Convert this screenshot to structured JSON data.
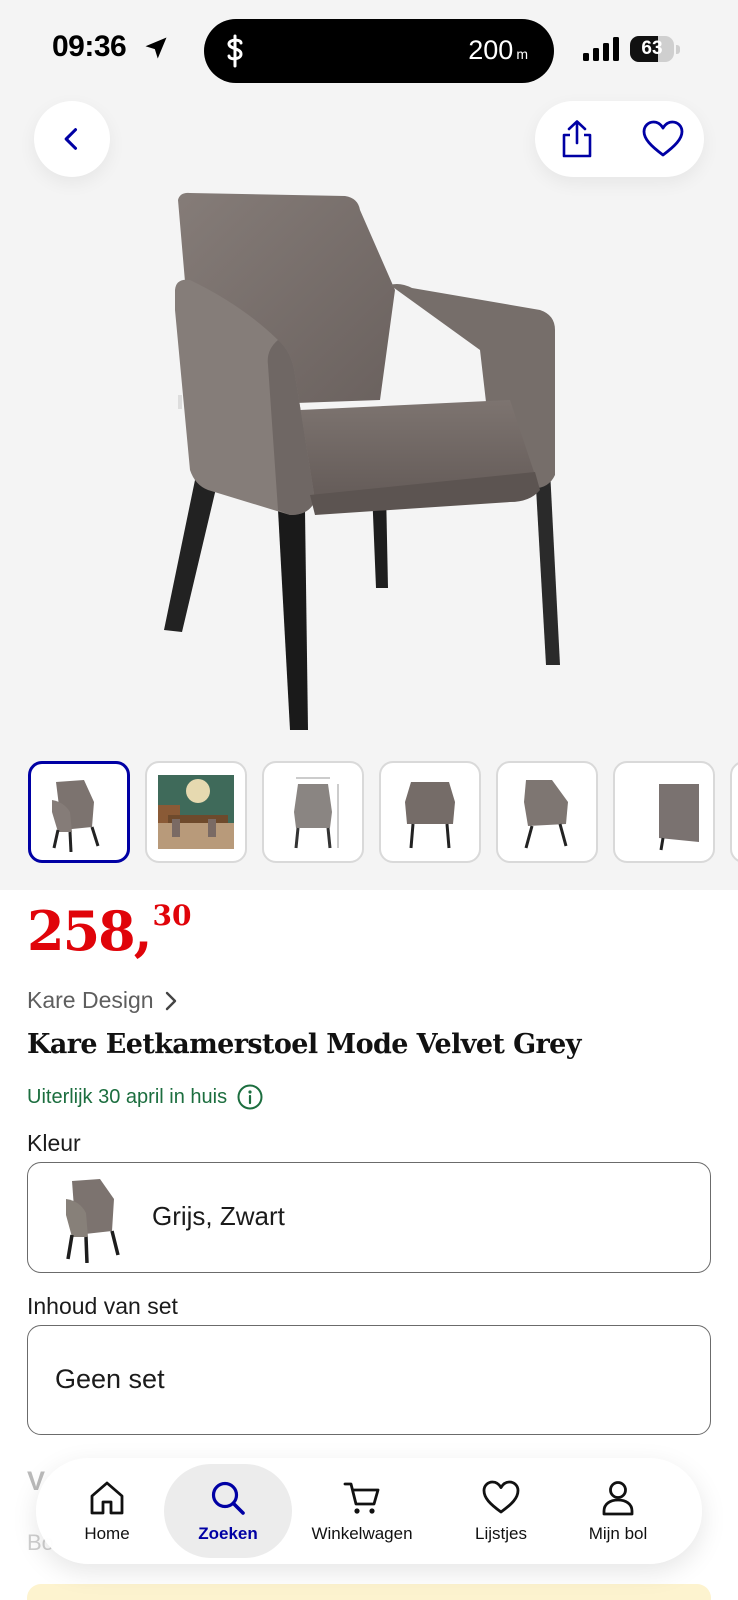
{
  "status_bar": {
    "time": "09:36",
    "navigation_distance": "200",
    "navigation_unit": "m",
    "battery_level": "63"
  },
  "product": {
    "price_whole": "258,",
    "price_cents": "30",
    "brand": "Kare Design",
    "title": "Kare Eetkamerstoel Mode Velvet Grey",
    "delivery": "Uiterlijk 30 april in huis",
    "color_label": "Kleur",
    "color_value": "Grijs, Zwart",
    "set_label": "Inhoud van set",
    "set_value": "Geen set",
    "partial_heading": "V",
    "partial_text": "Bo"
  },
  "tabbar": {
    "items": [
      {
        "label": "Home",
        "icon": "home-icon"
      },
      {
        "label": "Zoeken",
        "icon": "search-icon",
        "active": true
      },
      {
        "label": "Winkelwagen",
        "icon": "cart-icon"
      },
      {
        "label": "Lijstjes",
        "icon": "heart-icon"
      },
      {
        "label": "Mijn bol",
        "icon": "user-icon"
      }
    ]
  },
  "colors": {
    "price": "#e0040a",
    "brand_blue": "#0000a4",
    "delivery_green": "#1c6e3f",
    "gallery_bg": "#f4f4f4"
  }
}
